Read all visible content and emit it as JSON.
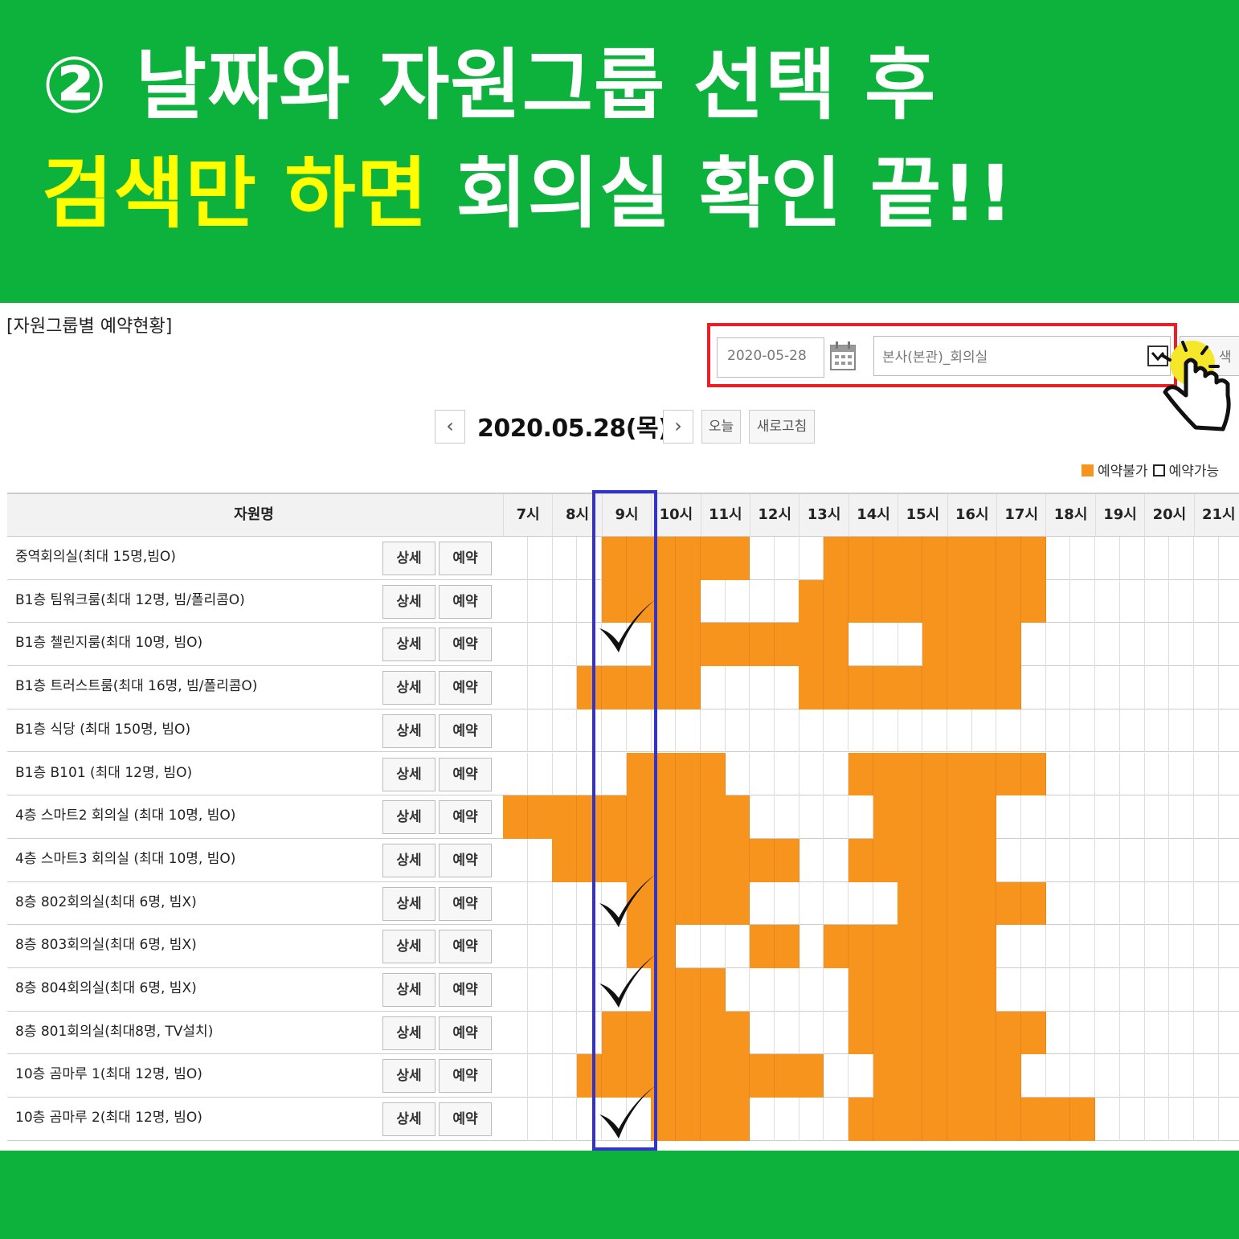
{
  "banner": {
    "line1": "② 날짜와 자원그룹 선택 후",
    "line2_highlight": "검색만 하면",
    "line2_rest": " 회의실 확인 끝!!"
  },
  "section_title": "[자원그룹별 예약현황]",
  "search": {
    "date_value": "2020-05-28",
    "group_value": "본사(본관)_회의실",
    "search_button": "색"
  },
  "nav": {
    "prev": "‹",
    "next": "›",
    "date_title": "2020.05.28(목)",
    "today": "오늘",
    "refresh": "새로고침"
  },
  "legend": {
    "busy_label": "예약불가",
    "free_label": "예약가능"
  },
  "table": {
    "name_header": "자원명",
    "hours": [
      "7시",
      "8시",
      "9시",
      "10시",
      "11시",
      "12시",
      "13시",
      "14시",
      "15시",
      "16시",
      "17시",
      "18시",
      "19시",
      "20시",
      "21시"
    ],
    "detail_label": "상세",
    "reserve_label": "예약",
    "rows": [
      {
        "name": "중역회의실(최대 15명,빔O)",
        "busy": [
          4,
          5,
          6,
          7,
          8,
          9,
          13,
          14,
          15,
          16,
          17,
          18,
          19,
          20,
          21
        ]
      },
      {
        "name": "B1층 팀워크룸(최대 12명, 빔/폴리콤O)",
        "busy": [
          4,
          5,
          6,
          7,
          12,
          13,
          14,
          15,
          16,
          17,
          18,
          19,
          20,
          21
        ]
      },
      {
        "name": "B1층 첼린지룸(최대 10명, 빔O)",
        "busy": [
          6,
          7,
          8,
          9,
          10,
          11,
          12,
          13,
          17,
          18,
          19,
          20
        ]
      },
      {
        "name": "B1층 트러스트룸(최대 16명, 빔/폴리콤O)",
        "busy": [
          3,
          4,
          5,
          6,
          7,
          12,
          13,
          14,
          15,
          16,
          17,
          18,
          19,
          20
        ]
      },
      {
        "name": "B1층 식당 (최대 150명, 빔O)",
        "busy": []
      },
      {
        "name": "B1층 B101 (최대 12명, 빔O)",
        "busy": [
          5,
          6,
          7,
          8,
          14,
          15,
          16,
          17,
          18,
          19,
          20,
          21
        ]
      },
      {
        "name": "4층 스마트2 회의실 (최대 10명, 빔O)",
        "busy": [
          0,
          1,
          2,
          3,
          4,
          5,
          6,
          7,
          8,
          9,
          15,
          16,
          17,
          18,
          19
        ]
      },
      {
        "name": "4층 스마트3 회의실 (최대 10명, 빔O)",
        "busy": [
          2,
          3,
          4,
          5,
          6,
          7,
          8,
          9,
          10,
          11,
          14,
          15,
          16,
          17,
          18,
          19
        ]
      },
      {
        "name": "8층 802회의실(최대 6명, 빔X)",
        "busy": [
          5,
          6,
          7,
          8,
          9,
          16,
          17,
          18,
          19,
          20,
          21
        ]
      },
      {
        "name": "8층 803회의실(최대 6명, 빔X)",
        "busy": [
          5,
          6,
          10,
          11,
          13,
          14,
          15,
          16,
          17,
          18,
          19
        ]
      },
      {
        "name": "8층 804회의실(최대 6명, 빔X)",
        "busy": [
          6,
          7,
          8,
          14,
          15,
          16,
          17,
          18,
          19
        ]
      },
      {
        "name": "8층 801회의실(최대8명, TV설치)",
        "busy": [
          4,
          5,
          6,
          7,
          8,
          9,
          14,
          15,
          16,
          17,
          18,
          19,
          20,
          21
        ]
      },
      {
        "name": "10층 곰마루 1(최대 12명, 빔O)",
        "busy": [
          3,
          4,
          5,
          6,
          7,
          8,
          9,
          10,
          11,
          12,
          15,
          16,
          17,
          18,
          19,
          20
        ]
      },
      {
        "name": "10층 곰마루 2(최대 12명, 빔O)",
        "busy": [
          6,
          7,
          8,
          9,
          14,
          15,
          16,
          17,
          18,
          19,
          20,
          21,
          22,
          23
        ]
      }
    ]
  },
  "colors": {
    "banner_green": "#0cb23c",
    "highlight_yellow": "#ffff00",
    "busy_orange": "#f7941d",
    "search_frame_red": "#ee1c25",
    "column_frame_blue": "#3333cc"
  }
}
